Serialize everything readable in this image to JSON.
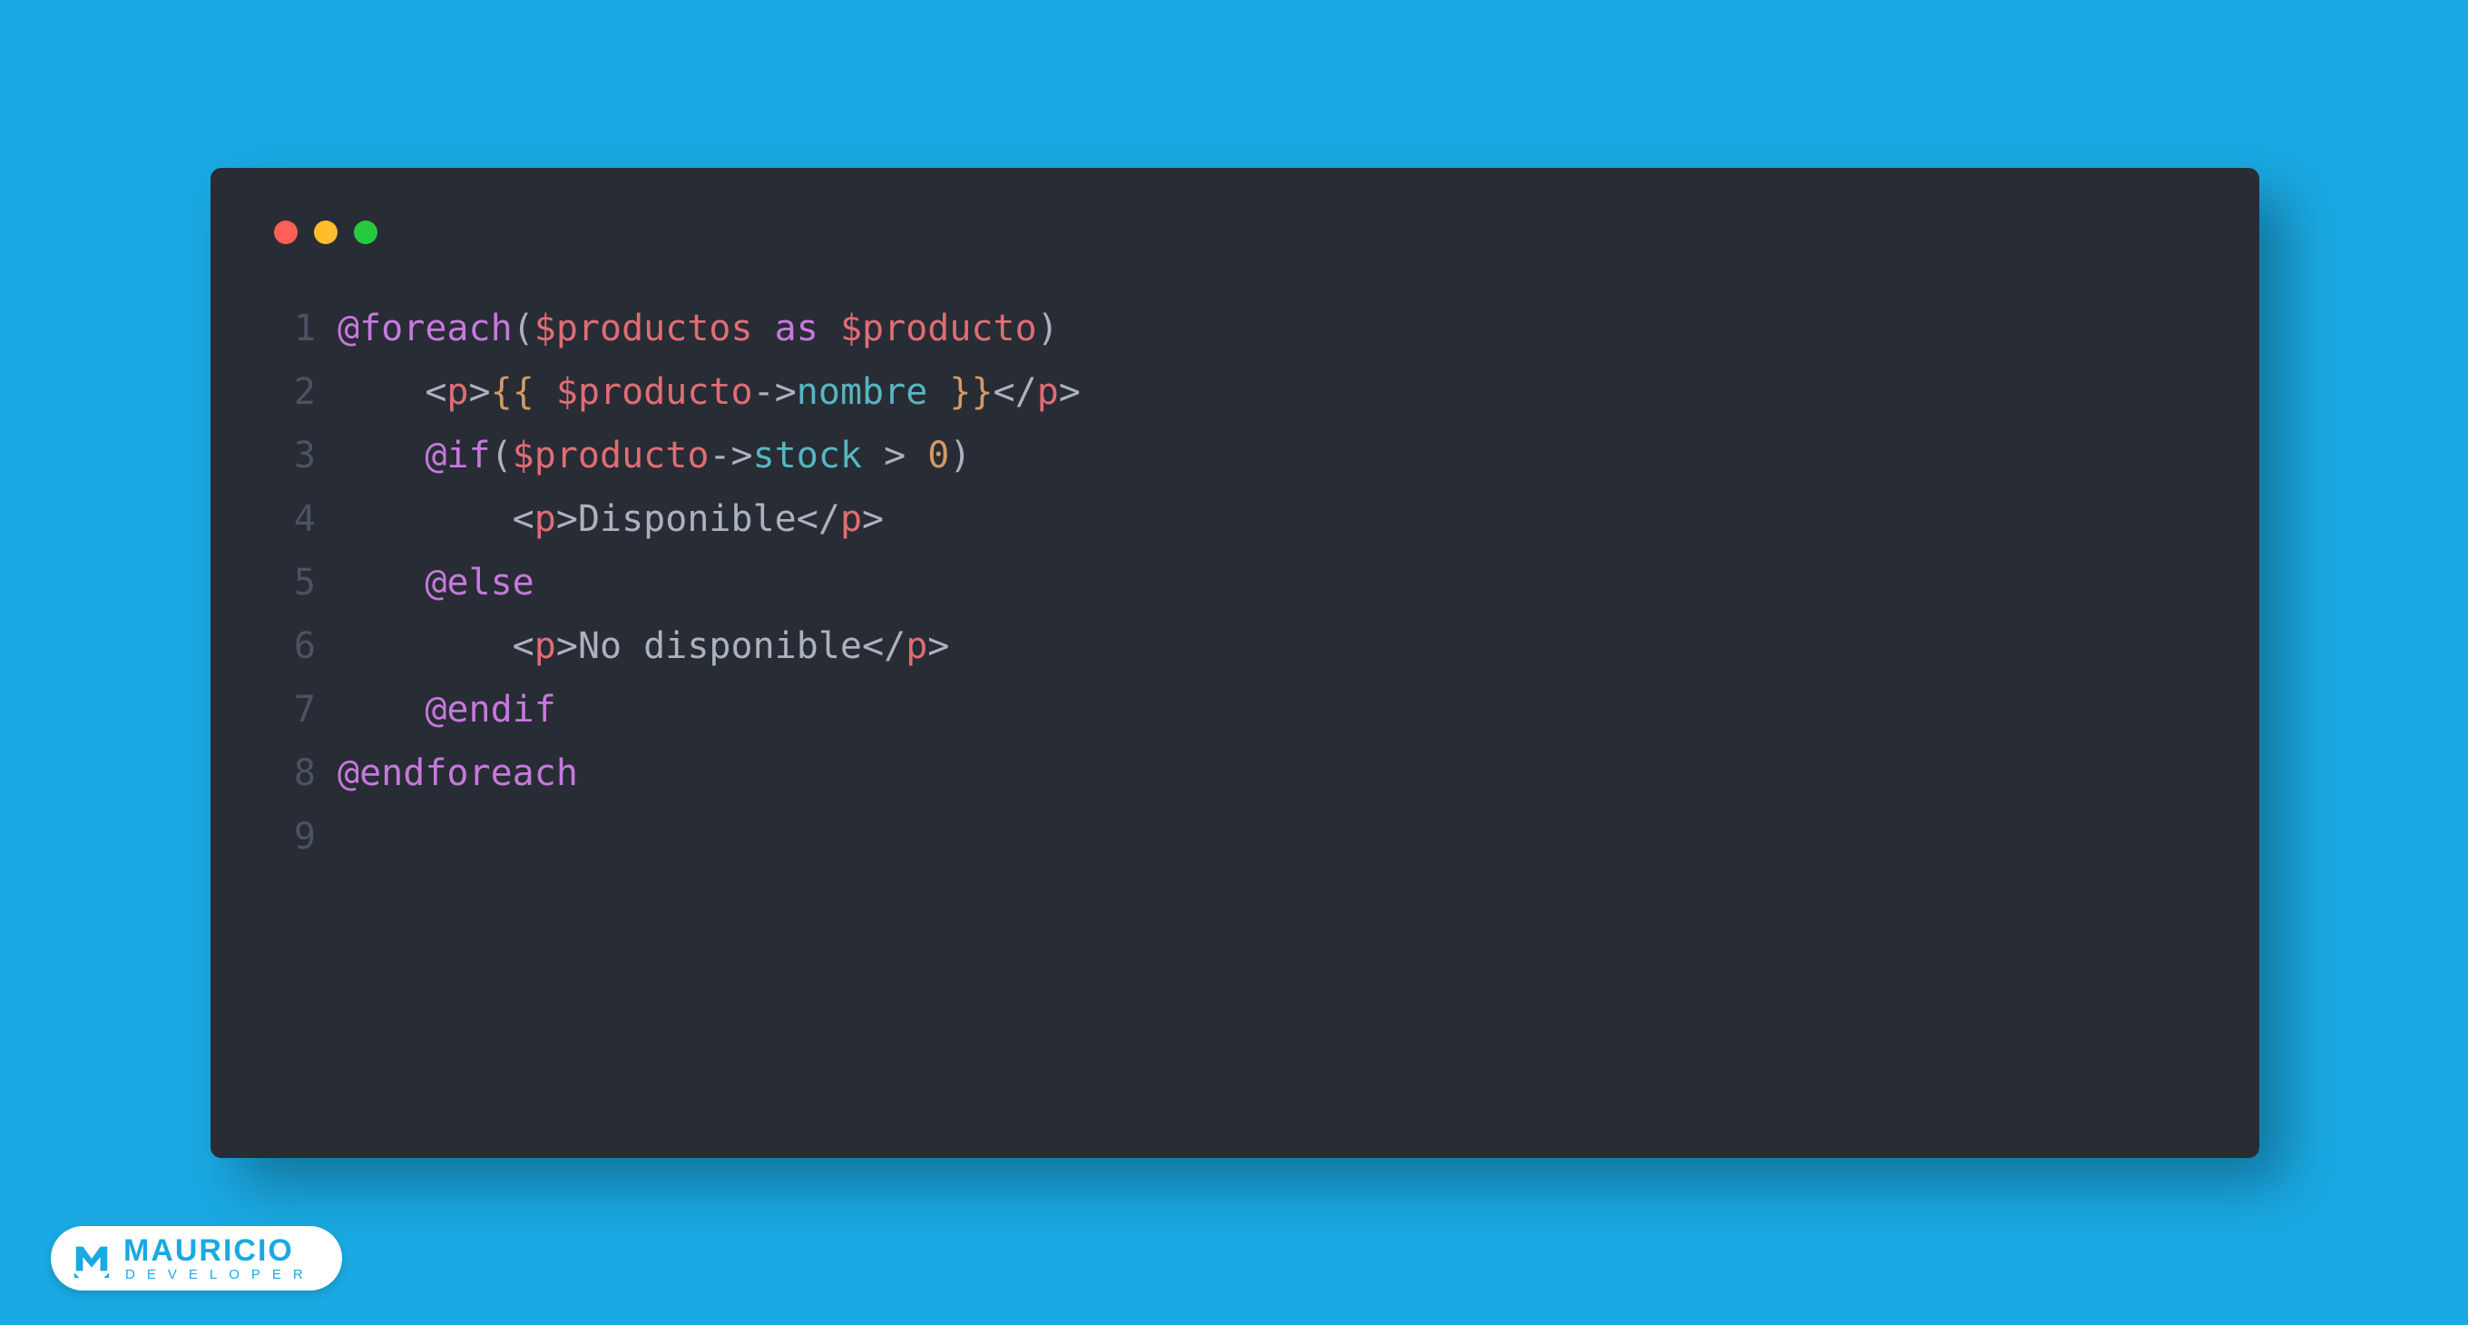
{
  "window": {
    "traffic_colors": {
      "red": "#FF5F56",
      "yellow": "#FFBD2E",
      "green": "#27C93F"
    }
  },
  "code": {
    "lines": [
      {
        "n": "1",
        "tokens": [
          {
            "t": "@foreach",
            "c": "tok-keyword"
          },
          {
            "t": "(",
            "c": "tok-default"
          },
          {
            "t": "$productos",
            "c": "tok-var"
          },
          {
            "t": " ",
            "c": "tok-default"
          },
          {
            "t": "as",
            "c": "tok-keyword"
          },
          {
            "t": " ",
            "c": "tok-default"
          },
          {
            "t": "$producto",
            "c": "tok-var"
          },
          {
            "t": ")",
            "c": "tok-default"
          }
        ]
      },
      {
        "n": "2",
        "tokens": [
          {
            "t": "    ",
            "c": "tok-default"
          },
          {
            "t": "<",
            "c": "tok-bracket"
          },
          {
            "t": "p",
            "c": "tok-tagname"
          },
          {
            "t": ">",
            "c": "tok-bracket"
          },
          {
            "t": "{{ ",
            "c": "tok-curly"
          },
          {
            "t": "$producto",
            "c": "tok-var"
          },
          {
            "t": "->",
            "c": "tok-op"
          },
          {
            "t": "nombre",
            "c": "tok-attr"
          },
          {
            "t": " }}",
            "c": "tok-curly"
          },
          {
            "t": "</",
            "c": "tok-bracket"
          },
          {
            "t": "p",
            "c": "tok-tagname"
          },
          {
            "t": ">",
            "c": "tok-bracket"
          }
        ]
      },
      {
        "n": "3",
        "tokens": [
          {
            "t": "    ",
            "c": "tok-default"
          },
          {
            "t": "@if",
            "c": "tok-keyword"
          },
          {
            "t": "(",
            "c": "tok-default"
          },
          {
            "t": "$producto",
            "c": "tok-var"
          },
          {
            "t": "->",
            "c": "tok-op"
          },
          {
            "t": "stock",
            "c": "tok-attr"
          },
          {
            "t": " > ",
            "c": "tok-op"
          },
          {
            "t": "0",
            "c": "tok-num"
          },
          {
            "t": ")",
            "c": "tok-default"
          }
        ]
      },
      {
        "n": "4",
        "tokens": [
          {
            "t": "        ",
            "c": "tok-default"
          },
          {
            "t": "<",
            "c": "tok-bracket"
          },
          {
            "t": "p",
            "c": "tok-tagname"
          },
          {
            "t": ">",
            "c": "tok-bracket"
          },
          {
            "t": "Disponible",
            "c": "tok-default"
          },
          {
            "t": "</",
            "c": "tok-bracket"
          },
          {
            "t": "p",
            "c": "tok-tagname"
          },
          {
            "t": ">",
            "c": "tok-bracket"
          }
        ]
      },
      {
        "n": "5",
        "tokens": [
          {
            "t": "    ",
            "c": "tok-default"
          },
          {
            "t": "@else",
            "c": "tok-keyword"
          }
        ]
      },
      {
        "n": "6",
        "tokens": [
          {
            "t": "        ",
            "c": "tok-default"
          },
          {
            "t": "<",
            "c": "tok-bracket"
          },
          {
            "t": "p",
            "c": "tok-tagname"
          },
          {
            "t": ">",
            "c": "tok-bracket"
          },
          {
            "t": "No disponible",
            "c": "tok-default"
          },
          {
            "t": "</",
            "c": "tok-bracket"
          },
          {
            "t": "p",
            "c": "tok-tagname"
          },
          {
            "t": ">",
            "c": "tok-bracket"
          }
        ]
      },
      {
        "n": "7",
        "tokens": [
          {
            "t": "    ",
            "c": "tok-default"
          },
          {
            "t": "@endif",
            "c": "tok-keyword"
          }
        ]
      },
      {
        "n": "8",
        "tokens": [
          {
            "t": "@endforeach",
            "c": "tok-keyword"
          }
        ]
      },
      {
        "n": "9",
        "tokens": [
          {
            "t": "",
            "c": "tok-default"
          }
        ]
      }
    ]
  },
  "branding": {
    "name": "MAURICIO",
    "subtitle": "DEVELOPER"
  }
}
